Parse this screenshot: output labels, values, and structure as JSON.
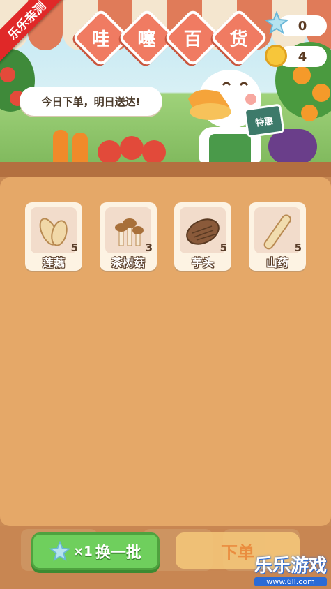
{
  "store": {
    "title_chars": [
      "哇",
      "噻",
      "百",
      "货"
    ],
    "speech": "今日下单，明日送达!",
    "shop_sign": "特惠"
  },
  "counters": {
    "stars": "0",
    "coins": "4"
  },
  "corner_tag": "乐乐亲测",
  "items": [
    {
      "name": "莲藕",
      "count": "5",
      "icon": "lotus-root-icon"
    },
    {
      "name": "茶树菇",
      "count": "3",
      "icon": "mushroom-icon"
    },
    {
      "name": "芋头",
      "count": "5",
      "icon": "taro-icon"
    },
    {
      "name": "山药",
      "count": "5",
      "icon": "yam-icon"
    }
  ],
  "buttons": {
    "refresh_multiplier": "×1",
    "refresh_label": "换一批",
    "order_label": "下单"
  },
  "watermark": {
    "brand": "乐乐游戏",
    "url": "www.6ll.com"
  },
  "colors": {
    "panel": "#e5a868",
    "title_tile": "#f07b62",
    "refresh_button": "#6fcf5d",
    "order_button": "#f6c87a"
  }
}
